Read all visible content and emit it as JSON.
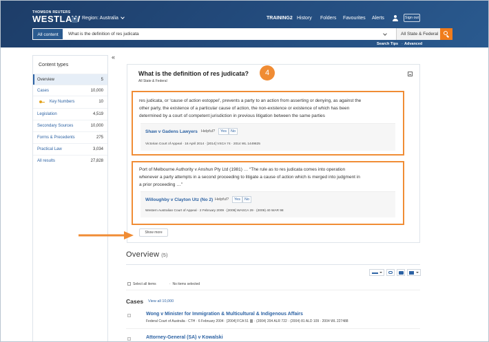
{
  "header": {
    "brand_small": "THOMSON REUTERS",
    "brand": "WESTLAW",
    "region": "Region: Australia",
    "nav": [
      "TRAINING2",
      "History",
      "Folders",
      "Favourites",
      "Alerts"
    ],
    "sign_out": "Sign out"
  },
  "search": {
    "scope": "All content",
    "query": "What is the definition of res judicata",
    "jurisdiction": "All State & Federal",
    "search_tips": "Search Tips",
    "advanced": "Advanced"
  },
  "sidebar": {
    "title": "Content types",
    "items": [
      {
        "label": "Overview",
        "count": "5"
      },
      {
        "label": "Cases",
        "count": "10,000"
      },
      {
        "label": "Key Numbers",
        "count": "10"
      },
      {
        "label": "Legislation",
        "count": "4,519"
      },
      {
        "label": "Secondary Sources",
        "count": "10,000"
      },
      {
        "label": "Forms & Precedents",
        "count": "275"
      },
      {
        "label": "Practical Law",
        "count": "3,034"
      },
      {
        "label": "All results",
        "count": "27,828"
      }
    ]
  },
  "answer": {
    "question": "What is the definition of res judicata?",
    "scope": "All State & Federal",
    "step": "4",
    "results": [
      {
        "lines": [
          "res judicata, or ‘cause of action estoppel’, prevents a party to an action from asserting or denying, as against the",
          "other party, the existence of a particular cause of action, the non-existence or existence of which has been",
          "determined by a court of competent jurisdiction in previous litigation between the same parties"
        ],
        "case": "Shaw v Gadens Lawyers",
        "helpful": "Helpful?",
        "yes": "Yes",
        "no": "No",
        "meta": "Victorian Court of Appeal  ·  16 April 2014  ·  [2014] VSCA 74  ·  2014 WL 1449825"
      },
      {
        "lines": [
          "Port of Melbourne Authority v Anshun Pty Ltd (1981) … “The rule as to res judicata comes into operation",
          "whenever a party attempts in a second proceeding to litigate a cause of action which is merged into judgment in",
          "a prior proceeding …”"
        ],
        "case": "Willoughby v Clayton Utz (No 2)",
        "helpful": "Helpful?",
        "yes": "Yes",
        "no": "No",
        "meta": "Western Australian Court of Appeal  ·  2 February 2009  ·  [2009] WASCA 29  ·  (2009) 40 WAR 98"
      }
    ],
    "show_more": "Show more"
  },
  "overview": {
    "title": "Overview",
    "count": "(5)",
    "select_all": "Select all items",
    "no_items": "No items selected",
    "cases_title": "Cases",
    "view_all": "View all 10,000",
    "cases": [
      {
        "name": "Wong v Minister for Immigration & Multicultural & Indigenous Affairs",
        "meta_left": "Federal Court of Australia  ·  CTH  ·  6 February 2004  ·  [2004] FCA 51",
        "meta_right": "·  (2004) 204 ALR 722  ·  (2004) 81 ALD 109  ·  2004 WL 227488"
      },
      {
        "name": "Attorney-General (SA) v Kowalski",
        "meta_left": "",
        "meta_right": ""
      }
    ]
  },
  "colors": {
    "header": "#22497a",
    "accent": "#f08c34",
    "link": "#2c62a3"
  }
}
